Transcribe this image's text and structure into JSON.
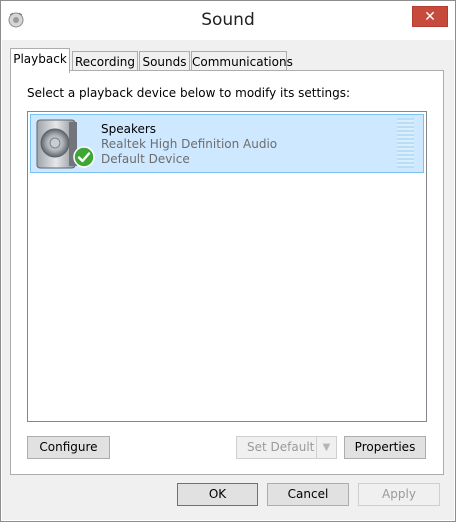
{
  "window": {
    "title": "Sound",
    "close_glyph": "✕"
  },
  "tabs": [
    {
      "label": "Playback",
      "active": true
    },
    {
      "label": "Recording",
      "active": false
    },
    {
      "label": "Sounds",
      "active": false
    },
    {
      "label": "Communications",
      "active": false
    }
  ],
  "playback": {
    "instruction": "Select a playback device below to modify its settings:",
    "devices": [
      {
        "name": "Speakers",
        "driver": "Realtek High Definition Audio",
        "status": "Default Device",
        "icon": "speaker-icon",
        "badge": "checkmark-icon",
        "selected": true
      }
    ],
    "configure_label": "Configure",
    "set_default_label": "Set Default",
    "properties_label": "Properties"
  },
  "footer": {
    "ok_label": "OK",
    "cancel_label": "Cancel",
    "apply_label": "Apply"
  },
  "colors": {
    "selection_bg": "#cde8ff",
    "selection_border": "#7ac2f3",
    "close_button": "#c74b3c",
    "default_button_border": "#3c7fb1",
    "check_badge": "#3fa535"
  }
}
